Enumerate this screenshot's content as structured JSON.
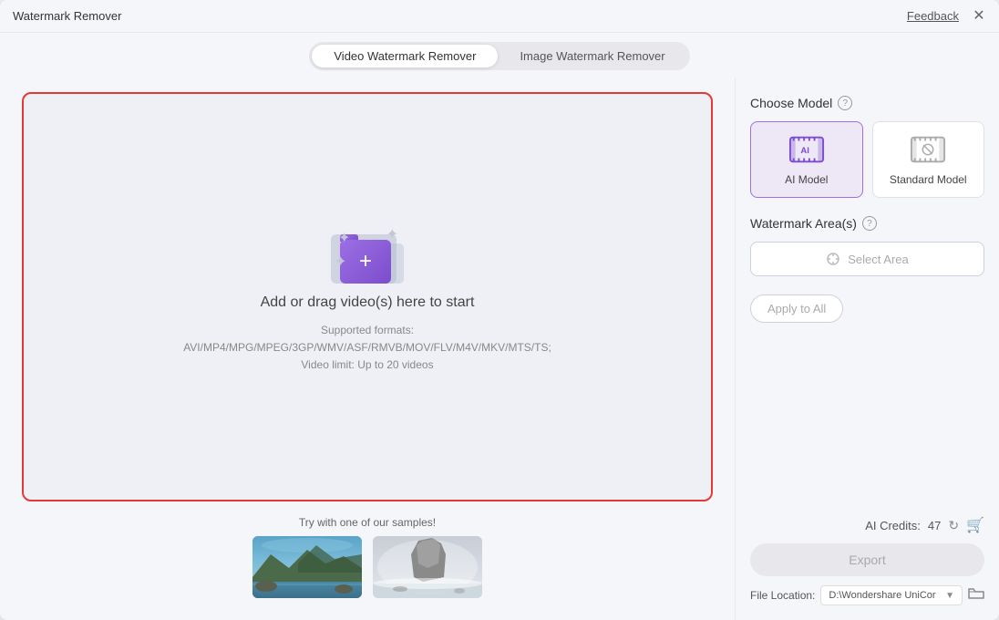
{
  "window": {
    "title": "Watermark Remover"
  },
  "titlebar": {
    "feedback_label": "Feedback",
    "close_label": "✕"
  },
  "tabs": {
    "video_label": "Video Watermark Remover",
    "image_label": "Image Watermark Remover",
    "active": "video"
  },
  "dropzone": {
    "main_text": "Add or drag video(s) here to start",
    "sub_text_line1": "Supported formats:",
    "sub_text_line2": "AVI/MP4/MPG/MPEG/3GP/WMV/ASF/RMVB/MOV/FLV/M4V/MKV/MTS/TS;",
    "sub_text_line3": "Video limit: Up to 20 videos"
  },
  "samples": {
    "label": "Try with one of our samples!"
  },
  "right_panel": {
    "choose_model_label": "Choose Model",
    "watermark_area_label": "Watermark Area(s)",
    "ai_model_label": "AI Model",
    "standard_model_label": "Standard Model",
    "select_area_label": "Select Area",
    "apply_all_label": "Apply to All",
    "ai_credits_label": "AI Credits:",
    "ai_credits_value": "47",
    "export_label": "Export",
    "file_location_label": "File Location:",
    "file_path_value": "D:\\Wondershare UniCor"
  }
}
